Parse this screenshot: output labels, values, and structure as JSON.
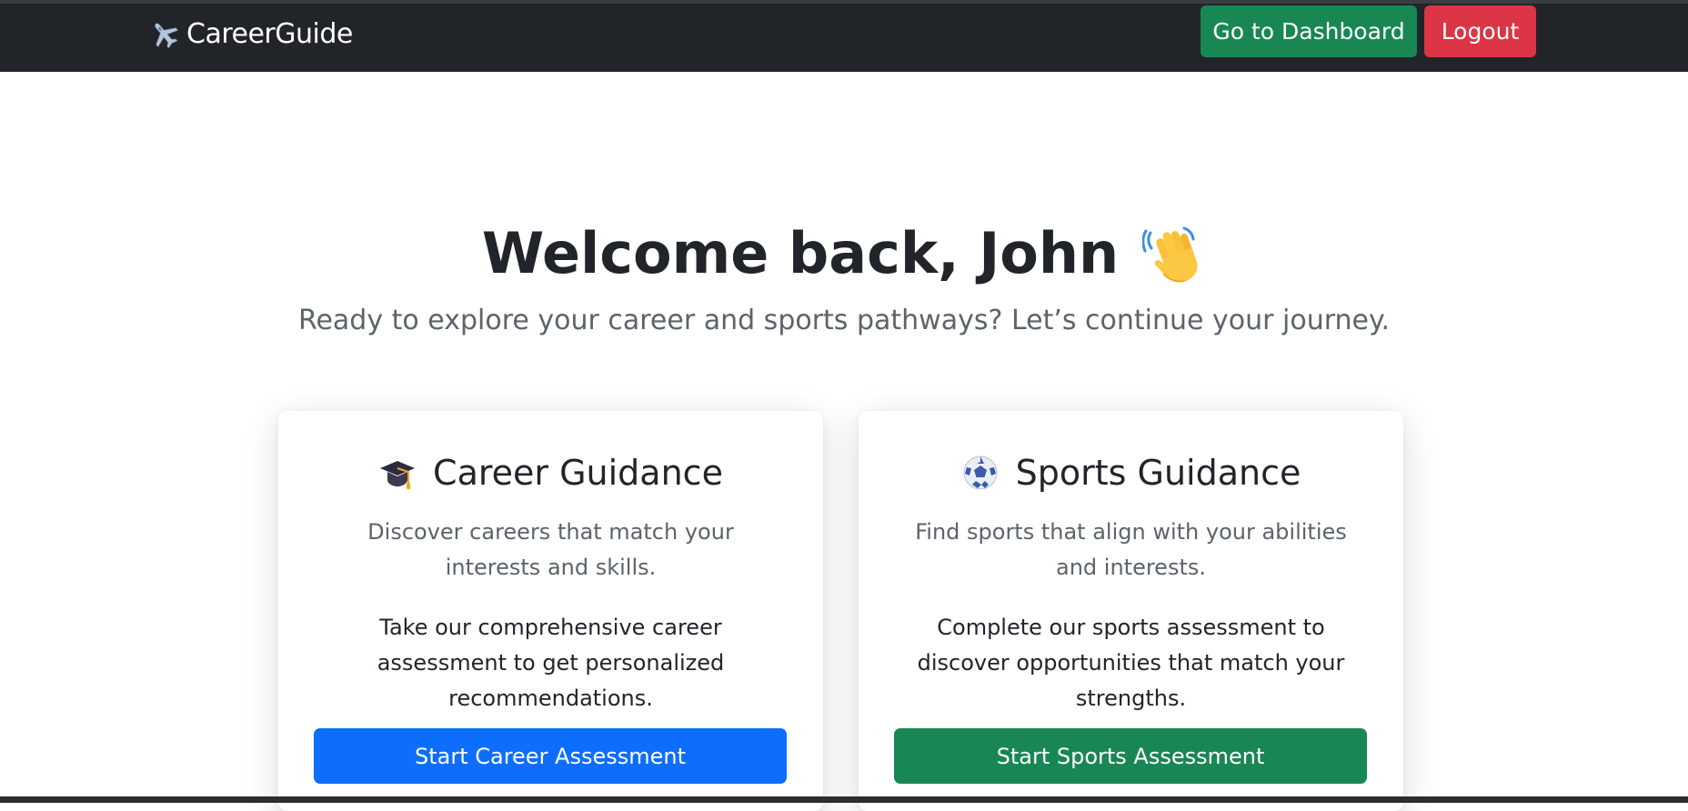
{
  "navbar": {
    "brand": {
      "icon": "airplane-icon",
      "name": "CareerGuide"
    },
    "dashboard_label": "Go to Dashboard",
    "logout_label": "Logout"
  },
  "hero": {
    "title": "Welcome back, John",
    "title_icon": "waving-hand-icon",
    "subtitle": "Ready to explore your career and sports pathways? Let’s continue your journey."
  },
  "cards": [
    {
      "icon": "graduation-cap-icon",
      "title": "Career Guidance",
      "description": "Discover careers that match your interests and skills.",
      "text": "Take our comprehensive career assessment to get personalized recommendations.",
      "button_label": "Start Career Assessment",
      "button_color": "#0d6efd"
    },
    {
      "icon": "soccer-ball-icon",
      "title": "Sports Guidance",
      "description": "Find sports that align with your abilities and interests.",
      "text": "Complete our sports assessment to discover opportunities that match your strengths.",
      "button_label": "Start Sports Assessment",
      "button_color": "#198754"
    }
  ],
  "colors": {
    "navbar_bg": "#212529",
    "success": "#198754",
    "danger": "#dc3545",
    "primary": "#0d6efd",
    "muted_text": "#5c636a"
  }
}
